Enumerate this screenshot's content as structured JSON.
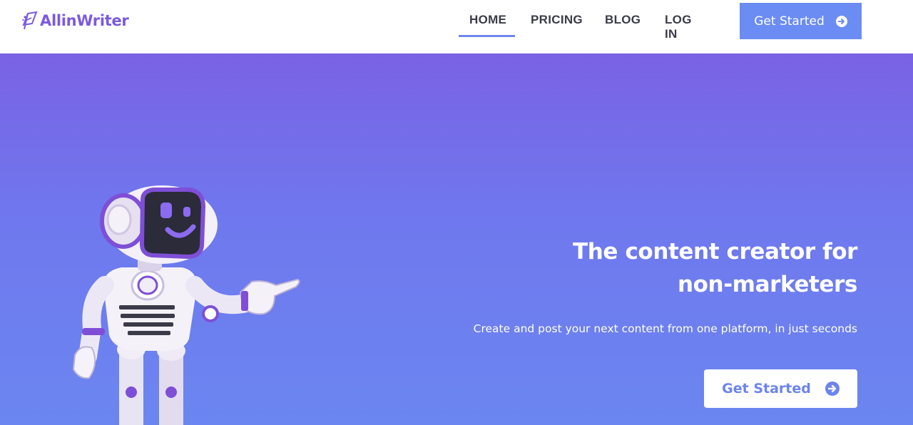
{
  "brand": {
    "name": "AllinWriter",
    "icon": "quill-logo-icon",
    "color": "#7b5ae0"
  },
  "nav": {
    "items": [
      {
        "label": "HOME",
        "active": true
      },
      {
        "label": "PRICING",
        "active": false
      },
      {
        "label": "BLOG",
        "active": false
      },
      {
        "label": "LOG IN",
        "active": false
      }
    ]
  },
  "header_cta": {
    "label": "Get Started",
    "icon": "arrow-right-circle-icon",
    "color": "#6b8cf2"
  },
  "hero": {
    "title_line1": "The content creator for",
    "title_line2": "non-marketers",
    "subtitle": "Create and post your next content from one platform, in just seconds",
    "cta": {
      "label": "Get Started",
      "icon": "arrow-right-circle-icon"
    },
    "gradient": [
      "#7a62e4",
      "#6b86f0"
    ],
    "illustration": "robot-illustration"
  }
}
